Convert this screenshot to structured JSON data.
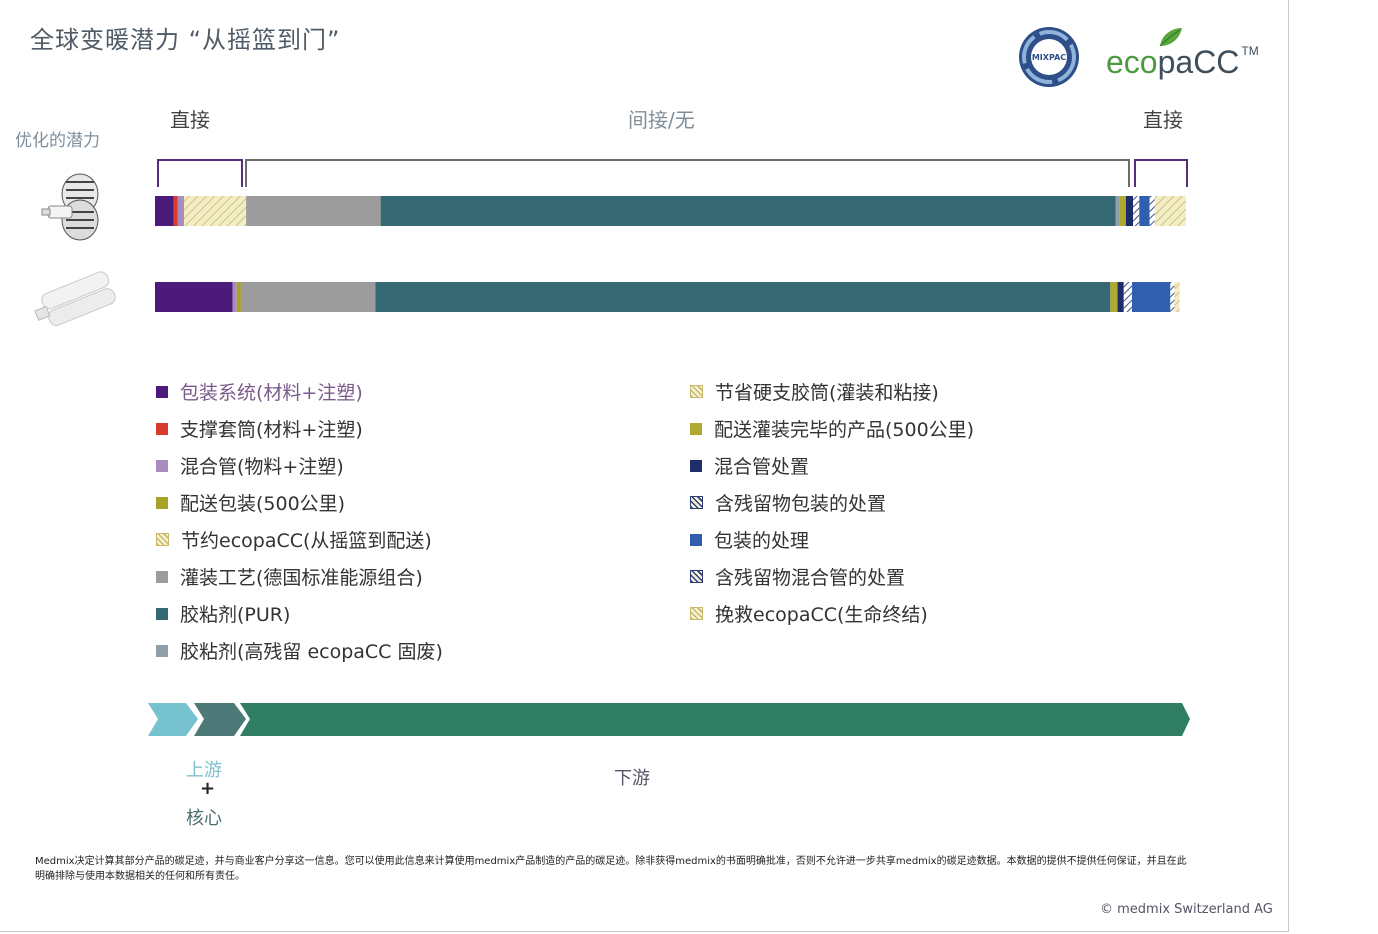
{
  "title": "全球变暖潜力 “从摇篮到门”",
  "logos": {
    "seal_text": "MIXPAC",
    "brand_eco": "eco",
    "brand_pacc": "paCC",
    "brand_tm": "TM"
  },
  "optimization_label": "优化的潜力",
  "headers": {
    "left": "直接",
    "middle": "间接/无",
    "right": "直接"
  },
  "colors": {
    "packaging_system": "#4b1a7a",
    "support_sleeve": "#d83a2e",
    "mixing_tube": "#a98bbf",
    "delivery_packaging": "#a8a327",
    "savings_ecopacc": "#efe9b8",
    "filling_process": "#9c9c9c",
    "adhesive_pur": "#356872",
    "adhesive_residue": "#8fa0a8",
    "hard_cartridge": "#efe9b8",
    "delivery_product": "#b0a930",
    "mixer_disposal": "#1d2d6a",
    "residue_pack_disposal": "#2f3c7a",
    "pack_disposal": "#2f5fae",
    "residue_mixer_disposal": "#2f3c7a",
    "rescue_ecopacc": "#e0d8a0",
    "arrow_upstream": "#76c3cf",
    "arrow_core": "#4d7a78",
    "arrow_downstream": "#2f7d63"
  },
  "chart_data": {
    "type": "bar",
    "orientation": "horizontal",
    "stacked": true,
    "categories": [
      "ecopaCC 胶筒",
      "硬支胶筒"
    ],
    "series": [
      {
        "name": "包装系统(材料+注塑)",
        "values": [
          1.8,
          7.5
        ],
        "pattern": "solid"
      },
      {
        "name": "支撑套筒(材料+注塑)",
        "values": [
          0.4,
          0
        ],
        "pattern": "solid"
      },
      {
        "name": "混合管(物料+注塑)",
        "values": [
          0.5,
          0.4
        ],
        "pattern": "solid"
      },
      {
        "name": "配送包装(500公里)",
        "values": [
          0.1,
          0.4
        ],
        "pattern": "solid"
      },
      {
        "name": "节约ecopaCC(从摇篮到配送)",
        "values": [
          6.0,
          0
        ],
        "pattern": "hatch"
      },
      {
        "name": "灌装工艺(德国标准能源组合)",
        "values": [
          13.0,
          13.0
        ],
        "pattern": "solid"
      },
      {
        "name": "胶粘剂(PUR)",
        "values": [
          71.0,
          71.0
        ],
        "pattern": "solid"
      },
      {
        "name": "胶粘剂(高残留 ecopaCC 固废)",
        "values": [
          0.4,
          0
        ],
        "pattern": "solid"
      },
      {
        "name": "配送灌装完毕的产品(500公里)",
        "values": [
          0.6,
          0.7
        ],
        "pattern": "solid"
      },
      {
        "name": "混合管处置",
        "values": [
          0.7,
          0.6
        ],
        "pattern": "solid"
      },
      {
        "name": "含残留物包装的处置",
        "values": [
          0.6,
          0.8
        ],
        "pattern": "hatch"
      },
      {
        "name": "包装的处理",
        "values": [
          1.0,
          3.7
        ],
        "pattern": "solid"
      },
      {
        "name": "含残留物混合管的处置",
        "values": [
          0.5,
          0.4
        ],
        "pattern": "hatch"
      },
      {
        "name": "挽救ecopaCC(生命终结)",
        "values": [
          3.0,
          0
        ],
        "pattern": "hatch"
      },
      {
        "name": "节省硬支胶筒(灌装和粘接)",
        "values": [
          0,
          0.5
        ],
        "pattern": "hatch"
      }
    ],
    "groups": [
      "直接",
      "间接/无",
      "直接"
    ],
    "xlim": [
      0,
      100
    ],
    "grid": false,
    "legend_position": "bottom"
  },
  "legend": {
    "left": [
      {
        "label": "包装系统(材料+注塑)",
        "color": "#4b1a7a",
        "pattern": "solid"
      },
      {
        "label": "支撑套筒(材料+注塑)",
        "color": "#d83a2e",
        "pattern": "solid"
      },
      {
        "label": "混合管(物料+注塑)",
        "color": "#a98bbf",
        "pattern": "solid"
      },
      {
        "label": "配送包装(500公里)",
        "color": "#a8a327",
        "pattern": "solid"
      },
      {
        "label": "节约ecopaCC(从摇篮到配送)",
        "color": "#c9b96a",
        "pattern": "hatch"
      },
      {
        "label": "灌装工艺(德国标准能源组合)",
        "color": "#9c9c9c",
        "pattern": "solid"
      },
      {
        "label": "胶粘剂(PUR)",
        "color": "#356872",
        "pattern": "solid"
      },
      {
        "label": "胶粘剂(高残留 ecopaCC 固废)",
        "color": "#8fa0a8",
        "pattern": "solid"
      }
    ],
    "right": [
      {
        "label": "节省硬支胶筒(灌装和粘接)",
        "color": "#c9b96a",
        "pattern": "hatch"
      },
      {
        "label": "配送灌装完毕的产品(500公里)",
        "color": "#b0a930",
        "pattern": "solid"
      },
      {
        "label": "混合管处置",
        "color": "#1d2d6a",
        "pattern": "solid"
      },
      {
        "label": "含残留物包装的处置",
        "color": "#2f3c7a",
        "pattern": "hatch"
      },
      {
        "label": "包装的处理",
        "color": "#2f5fae",
        "pattern": "solid"
      },
      {
        "label": "含残留物混合管的处置",
        "color": "#2f3c7a",
        "pattern": "hatch"
      },
      {
        "label": "挽救ecopaCC(生命终结)",
        "color": "#c9b96a",
        "pattern": "hatch"
      }
    ]
  },
  "flow": {
    "upstream": "上游",
    "plus": "+",
    "core": "核心",
    "downstream": "下游"
  },
  "disclaimer": "Medmix决定计算其部分产品的碳足迹，并与商业客户分享这一信息。您可以使用此信息来计算使用medmix产品制造的产品的碳足迹。除非获得medmix的书面明确批准，否则不允许进一步共享medmix的碳足迹数据。本数据的提供不提供任何保证，并且在此明确排除与使用本数据相关的任何和所有责任。",
  "copyright": "© medmix Switzerland AG"
}
